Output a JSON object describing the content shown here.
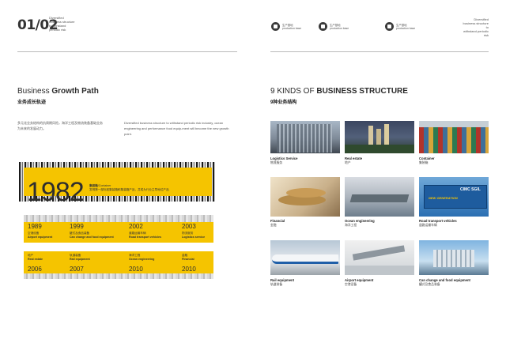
{
  "header": {
    "logo": "01/02",
    "left_note": [
      "Diversified",
      "business structure",
      "to withstand",
      "periodic risk"
    ],
    "icons": [
      {
        "icon": "production-icon",
        "zh": "生产基地",
        "en": "production base"
      },
      {
        "icon": "production-icon",
        "zh": "生产基地",
        "en": "production base"
      },
      {
        "icon": "production-icon",
        "zh": "生产基地",
        "en": "production base"
      }
    ],
    "right_note": [
      "Diversified",
      "business structure",
      "to",
      "withstand periodic risk"
    ]
  },
  "left": {
    "title_light": "Business ",
    "title_bold": "Growth Path",
    "subtitle": "业务成长轨迹",
    "para_zh": "多元化业务结构的抗周期风险，海洋工程及物流装备基础业务为未来的发展动力。",
    "para_en": "Diversified business structure to withstand periodic risk industry, ocean engineering and performance food equip-ment will become the new growth point.",
    "hero_year": "1982",
    "hero_head": "集装箱",
    "hero_head_en": "/Container",
    "hero_desc": "发明第一部标准集装箱和集装箱产品，并成为行业主导地位产品",
    "top_events": [
      {
        "year": "1989",
        "zh": "空港设备",
        "en": "Airport equipment"
      },
      {
        "year": "1999",
        "zh": "罐式及食品装备",
        "en": "Can change and food equipment"
      },
      {
        "year": "2002",
        "zh": "道路运输车辆",
        "en": "Road transport vehicles"
      },
      {
        "year": "2003",
        "zh": "物流服务",
        "en": "Logistics service"
      }
    ],
    "bottom_events": [
      {
        "year": "2006",
        "zh": "地产",
        "en": "Real estate"
      },
      {
        "year": "2007",
        "zh": "轨道装备",
        "en": "Rail equipment"
      },
      {
        "year": "2010",
        "zh": "海洋工程",
        "en": "Ocean engineering"
      },
      {
        "year": "2010",
        "zh": "金融",
        "en": "Financial"
      }
    ]
  },
  "right": {
    "title_light": "9 KINDS OF ",
    "title_bold": "BUSINESS STRUCTURE",
    "subtitle": "9种业务结构",
    "items": [
      {
        "en": "Logistics Service",
        "zh": "物流服务"
      },
      {
        "en": "Real estate",
        "zh": "地产"
      },
      {
        "en": "Container",
        "zh": "集装箱"
      },
      {
        "en": "Financial",
        "zh": "金融"
      },
      {
        "en": "Ocean engineering",
        "zh": "海洋工程"
      },
      {
        "en": "Road transport vehicles",
        "zh": "道路运输车辆"
      },
      {
        "en": "Rail equipment",
        "zh": "轨道装备"
      },
      {
        "en": "Airport equipment",
        "zh": "空港设备"
      },
      {
        "en": "Can change and food equipment",
        "zh": "罐式及食品装备"
      }
    ],
    "trailer_brand": "CIMC SGIL",
    "trailer_slogan": "NEW GENERATION"
  }
}
